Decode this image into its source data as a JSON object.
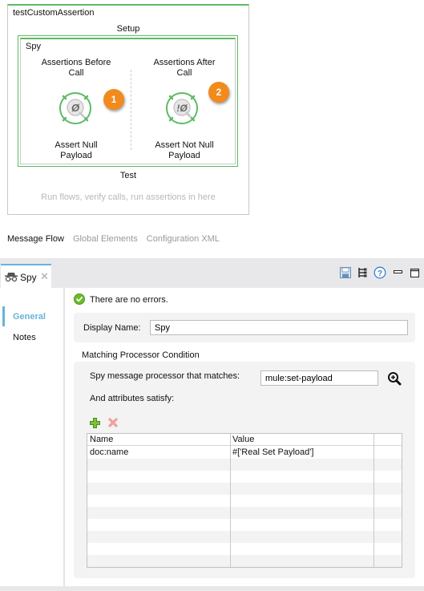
{
  "canvas": {
    "flow_title": "testCustomAssertion",
    "setup_label": "Setup",
    "scope": {
      "title": "Spy",
      "columns": [
        {
          "title_line1": "Assertions Before",
          "title_line2": "Call",
          "processor": {
            "icon": "null-payload-icon",
            "glyph": "Ø",
            "label_line1": "Assert Null",
            "label_line2": "Payload"
          },
          "badge": "1"
        },
        {
          "title_line1": "Assertions After",
          "title_line2": "Call",
          "processor": {
            "icon": "not-null-payload-icon",
            "glyph": "!Ø",
            "label_line1": "Assert Not Null",
            "label_line2": "Payload"
          },
          "badge": "2"
        }
      ]
    },
    "test_label": "Test",
    "test_hint": "Run flows, verify calls, run assertions in here"
  },
  "editor_tabs": [
    {
      "label": "Message Flow",
      "active": true
    },
    {
      "label": "Global Elements",
      "active": false
    },
    {
      "label": "Configuration XML",
      "active": false
    }
  ],
  "properties": {
    "tab": {
      "label": "Spy",
      "icon": "spy-glasses-icon",
      "close": "✕"
    },
    "toolbar": [
      "save-icon",
      "tree-icon",
      "help-icon",
      "minimize-icon",
      "maximize-icon"
    ],
    "nav": [
      {
        "label": "General",
        "active": true
      },
      {
        "label": "Notes",
        "active": false
      }
    ],
    "status_text": "There are no errors.",
    "display_name": {
      "label": "Display Name:",
      "value": "Spy"
    },
    "matching_group": {
      "title": "Matching Processor Condition",
      "matcher_label": "Spy message processor that matches:",
      "matcher_value": "mule:set-payload",
      "attrs_label": "And attributes satisfy:",
      "table": {
        "columns": [
          "Name",
          "Value",
          ""
        ],
        "rows": [
          {
            "name": "doc:name",
            "value": "#['Real Set Payload']"
          }
        ]
      }
    }
  },
  "colors": {
    "scope_green": "#5dbb63",
    "badge_orange": "#f28a1c",
    "nav_accent": "#6ab3d9"
  }
}
